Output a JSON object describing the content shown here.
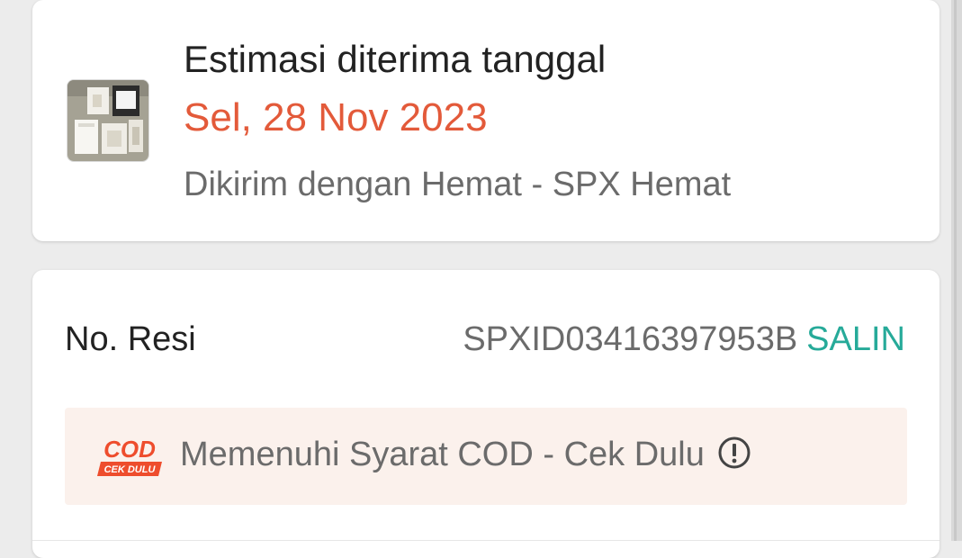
{
  "delivery": {
    "heading": "Estimasi diterima tanggal",
    "date": "Sel, 28 Nov 2023",
    "method": "Dikirim dengan Hemat - SPX Hemat",
    "date_color": "#e35a3a"
  },
  "shipping": {
    "tracking_label": "No. Resi",
    "tracking_number": "SPXID03416397953B",
    "copy_label": "SALIN",
    "copy_color": "#26aa99"
  },
  "cod": {
    "logo_top": "COD",
    "logo_bottom": "CEK DULU",
    "text": "Memenuhi Syarat COD - Cek Dulu",
    "icon": "info-icon",
    "brand_color": "#ee4d2d"
  }
}
